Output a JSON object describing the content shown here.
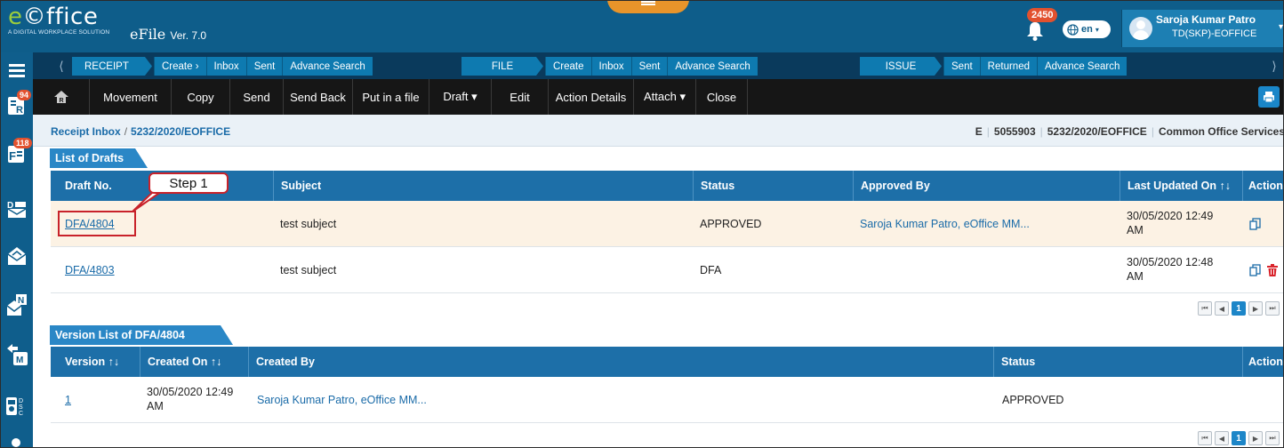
{
  "header": {
    "brand": "e©ffice",
    "tagline": "A DIGITAL WORKPLACE SOLUTION",
    "app_name": "eFile",
    "version": "Ver. 7.0",
    "notification_count": "2450",
    "language": "en",
    "user_name": "Saroja Kumar Patro",
    "user_role": "TD(SKP)-EOFFICE"
  },
  "sidebar": {
    "receipt_badge": "94",
    "file_badge": "118",
    "dsc_label": "D S C"
  },
  "nav": {
    "receipt": {
      "label": "RECEIPT",
      "links": [
        "Create ›",
        "Inbox",
        "Sent",
        "Advance Search"
      ]
    },
    "file": {
      "label": "FILE",
      "links": [
        "Create",
        "Inbox",
        "Sent",
        "Advance Search"
      ]
    },
    "issue": {
      "label": "ISSUE",
      "links": [
        "Sent",
        "Returned",
        "Advance Search"
      ]
    }
  },
  "toolbar": {
    "movement": "Movement",
    "copy": "Copy",
    "send": "Send",
    "send_back": "Send Back",
    "put_in_file": "Put in a file",
    "draft": "Draft ▾",
    "edit": "Edit",
    "action_details": "Action Details",
    "attach": "Attach ▾",
    "close": "Close"
  },
  "breadcrumb": {
    "root": "Receipt Inbox",
    "separator": "/",
    "current": "5232/2020/EOFFICE"
  },
  "info": {
    "type": "E",
    "number": "5055903",
    "file_no": "5232/2020/EOFFICE",
    "department": "Common Office Services"
  },
  "drafts": {
    "section_title": "List of Drafts",
    "columns": [
      "Draft No.",
      "Subject",
      "Status",
      "Approved By",
      "Last Updated On ↑↓",
      "Action"
    ],
    "rows": [
      {
        "draft_no": "DFA/4804",
        "subject": "test subject",
        "status": "APPROVED",
        "approved_by": "Saroja Kumar Patro, eOffice MM...",
        "updated_date": "30/05/2020 12:49",
        "updated_ampm": "AM"
      },
      {
        "draft_no": "DFA/4803",
        "subject": "test subject",
        "status": "DFA",
        "approved_by": "",
        "updated_date": "30/05/2020 12:48",
        "updated_ampm": "AM"
      }
    ],
    "current_page": "1"
  },
  "versions": {
    "section_title": "Version List of DFA/4804",
    "columns": [
      "Version ↑↓",
      "Created On ↑↓",
      "Created By",
      "Status",
      "Action"
    ],
    "rows": [
      {
        "version": "1",
        "created_date": "30/05/2020 12:49",
        "created_ampm": "AM",
        "created_by": "Saroja Kumar Patro, eOffice MM...",
        "status": "APPROVED"
      }
    ],
    "current_page": "1"
  },
  "annotation": {
    "callout_label": "Step 1",
    "colors": {
      "callout_border": "#c8222a"
    }
  },
  "colors": {
    "header_bg": "#0e5d8a",
    "navbar_bg": "#0a3a5c",
    "nav_button": "#0e7ab0",
    "toolbar_bg": "#161616",
    "table_header": "#1d6fa8",
    "highlight_row": "#fcf2e4",
    "badge": "#e2512e"
  }
}
